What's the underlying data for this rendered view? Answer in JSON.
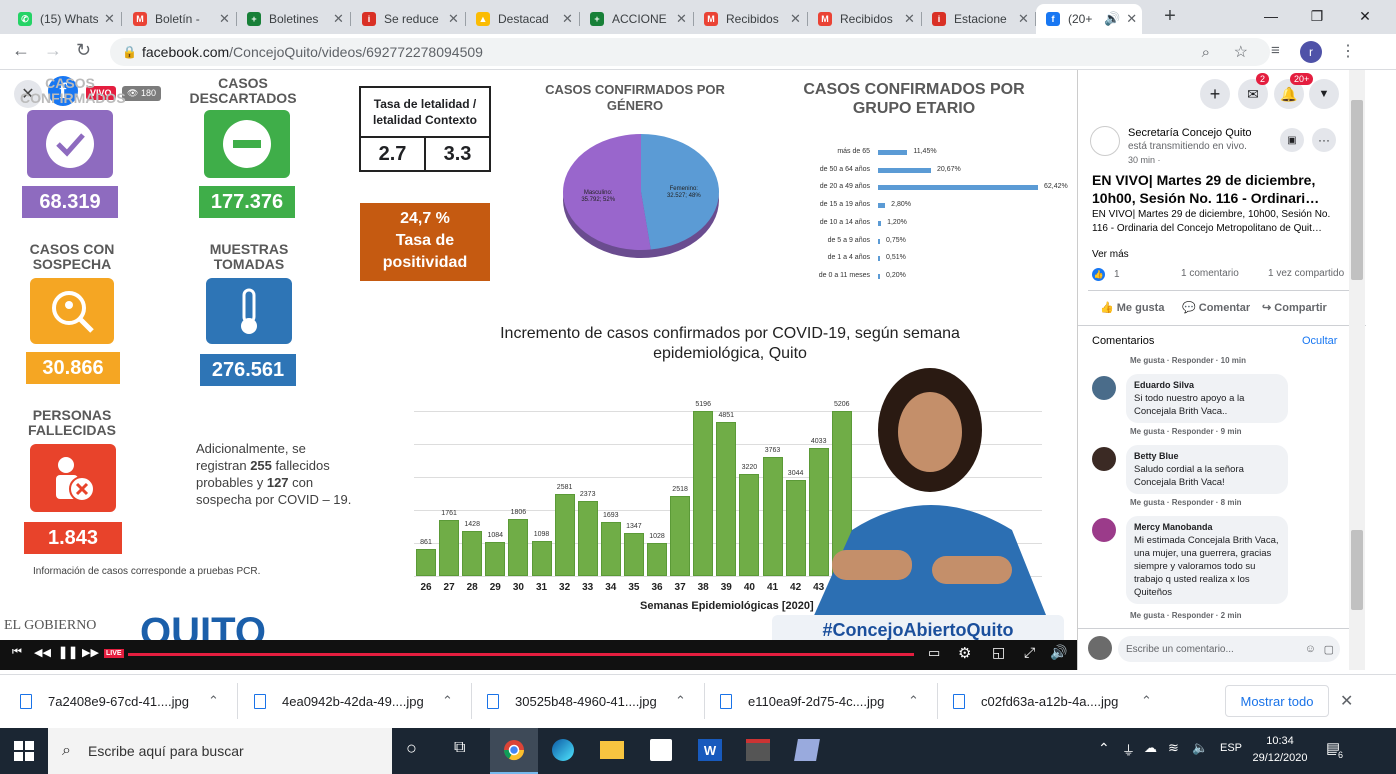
{
  "browser": {
    "tabs": [
      {
        "title": "(15) Whats",
        "icon": "whatsapp-icon",
        "color": "#25d366"
      },
      {
        "title": "Boletín -",
        "icon": "gmail-icon",
        "color": "#ea4335"
      },
      {
        "title": "Boletines",
        "icon": "sheets-icon",
        "color": "#188038"
      },
      {
        "title": "Se reduce",
        "icon": "info-icon",
        "color": "#d93025"
      },
      {
        "title": "Destacad",
        "icon": "drive-icon",
        "color": "#fbbc04"
      },
      {
        "title": "ACCIONE",
        "icon": "sheets-icon",
        "color": "#188038"
      },
      {
        "title": "Recibidos",
        "icon": "gmail-icon",
        "color": "#ea4335"
      },
      {
        "title": "Recibidos",
        "icon": "gmail-icon",
        "color": "#ea4335"
      },
      {
        "title": "Estacione",
        "icon": "info-icon",
        "color": "#d93025"
      },
      {
        "title": "(20+",
        "icon": "facebook-icon",
        "color": "#1877f2"
      }
    ],
    "url_domain": "facebook.com",
    "url_path": "/ConcejoQuito/videos/692772278094509",
    "profile_initial": "r"
  },
  "video": {
    "live_badge": "VIVO",
    "viewers": "180",
    "hashtag": "#ConcejoAbiertoQuito",
    "stats": [
      {
        "label": "CASOS CONFIRMADOS",
        "value": "68.319",
        "color": "#8e6bbf"
      },
      {
        "label": "CASOS DESCARTADOS",
        "value": "177.376",
        "color": "#3fae49"
      },
      {
        "label": "CASOS CON SOSPECHA",
        "value": "30.866",
        "color": "#f5a623"
      },
      {
        "label": "MUESTRAS TOMADAS",
        "value": "276.561",
        "color": "#2e75b6"
      },
      {
        "label": "PERSONAS FALLECIDAS",
        "value": "1.843",
        "color": "#e8432b"
      }
    ],
    "lethality": {
      "title_line1": "Tasa de letalidad /",
      "title_line2": "letalidad Contexto",
      "v1": "2.7",
      "v2": "3.3"
    },
    "positivity": {
      "value": "24,7 %",
      "line1": "Tasa de",
      "line2": "positividad"
    },
    "extra_text": {
      "a": "Adicionalmente, se",
      "b": "registran ",
      "c": "255",
      "d": " fallecidos probables y",
      "e": "127",
      "f": " con sospecha por",
      "g": "COVID – 19."
    },
    "note": "Información de casos corresponde a pruebas PCR.",
    "gobierno": "EL GOBIERNO",
    "quito": "QUITO"
  },
  "chart_data": [
    {
      "type": "pie",
      "title": "CASOS CONFIRMADOS POR GÉNERO",
      "slices": [
        {
          "label": "Masculino",
          "text": "35.792; 52%",
          "value": 52,
          "color": "#9966cc"
        },
        {
          "label": "Femenino",
          "text": "32.527; 48%",
          "value": 48,
          "color": "#5b9bd5"
        }
      ]
    },
    {
      "type": "bar",
      "title": "CASOS CONFIRMADOS POR GRUPO ETARIO",
      "orientation": "horizontal",
      "categories": [
        "más de 65",
        "de 50 a 64 años",
        "de 20 a 49 años",
        "de 15 a 19 años",
        "de 10 a 14 años",
        "de 5 a 9 años",
        "de 1 a 4 años",
        "de 0 a 11 meses"
      ],
      "values": [
        11.45,
        20.67,
        62.42,
        2.8,
        1.2,
        0.75,
        0.51,
        0.2
      ],
      "labels": [
        "11,45%",
        "20,67%",
        "62,42%",
        "2,80%",
        "1,20%",
        "0,75%",
        "0,51%",
        "0,20%"
      ]
    },
    {
      "type": "bar",
      "title": "Incremento de casos confirmados por COVID-19, según semana epidemiológica, Quito",
      "xlabel": "Semanas Epidemiológicas [2020]",
      "categories": [
        "26",
        "27",
        "28",
        "29",
        "30",
        "31",
        "32",
        "33",
        "34",
        "35",
        "36",
        "37",
        "38",
        "39",
        "40",
        "41",
        "42",
        "43"
      ],
      "values": [
        861,
        1761,
        1428,
        1084,
        1806,
        1098,
        2581,
        2373,
        1693,
        1347,
        1028,
        2518,
        5196,
        4851,
        3220,
        3763,
        3044,
        4033
      ],
      "extra_value": 5206
    }
  ],
  "sidebar": {
    "page_name": "Secretaría Concejo Quito",
    "status": "está transmitiendo en vivo.",
    "time": "30 min ·",
    "title": "EN VIVO| Martes 29 de diciembre, 10h00, Sesión No. 116 - Ordinari…",
    "desc": "EN VIVO| Martes 29 de diciembre, 10h00, Sesión No. 116 - Ordinaria del Concejo Metropolitano de Quit…",
    "see_more": "Ver más",
    "likes": "1",
    "comments_count": "1 comentario",
    "shares": "1 vez compartido",
    "like": "Me gusta",
    "comment": "Comentar",
    "share": "Compartir",
    "comments_header": "Comentarios",
    "hide": "Ocultar",
    "badge_messenger": "2",
    "badge_notif": "20+",
    "top_meta": "Me gusta · Responder · 10 min",
    "comments": [
      {
        "name": "Eduardo Silva",
        "text": "Si todo nuestro apoyo a la Concejala Brith Vaca..",
        "meta": "Me gusta · Responder · 9 min"
      },
      {
        "name": "Betty Blue",
        "text": "Saludo cordial a la señora Concejala Brith Vaca!",
        "meta": "Me gusta · Responder · 8 min"
      },
      {
        "name": "Mercy Manobanda",
        "text": "Mi estimada Concejala Brith Vaca, una mujer, una guerrera, gracias siempre y valoramos todo su trabajo q usted realiza x los Quiteños",
        "meta": "Me gusta · Responder · 2 min"
      }
    ],
    "write_placeholder": "Escribe un comentario..."
  },
  "downloads": {
    "files": [
      "7a2408e9-67cd-41....jpg",
      "4ea0942b-42da-49....jpg",
      "30525b48-4960-41....jpg",
      "e110ea9f-2d75-4c....jpg",
      "c02fd63a-a12b-4a....jpg"
    ],
    "show_all": "Mostrar todo"
  },
  "taskbar": {
    "search": "Escribe aquí para buscar",
    "lang": "ESP",
    "time": "10:34",
    "date": "29/12/2020",
    "notif": "6"
  }
}
